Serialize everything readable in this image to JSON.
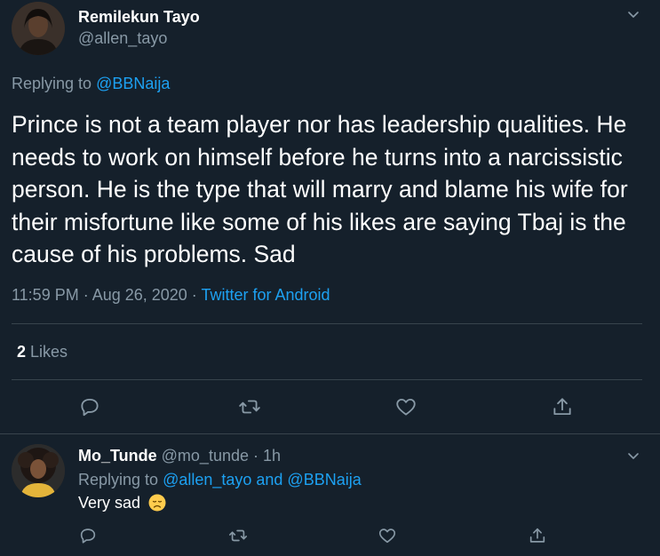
{
  "main_tweet": {
    "author_name": "Remilekun Tayo",
    "author_handle": "@allen_tayo",
    "replying_prefix": "Replying to",
    "replying_to": "@BBNaija",
    "text": "Prince is not a team player nor has leadership qualities. He needs to work on himself before he turns into a narcissistic person. He is the type that will marry and blame his wife for their misfortune like some of his likes are saying Tbaj is the cause of his problems. Sad",
    "timestamp": "11:59 PM · Aug 26, 2020 · ",
    "source": "Twitter for Android",
    "likes_count": "2",
    "likes_label": " Likes",
    "icons": {
      "reply": "reply-icon",
      "retweet": "retweet-icon",
      "like": "heart-icon",
      "share": "share-icon",
      "more": "chevron-down-icon"
    }
  },
  "reply_tweet": {
    "author_name": "Mo_Tunde",
    "author_handle": " @mo_tunde · 1h",
    "replying_prefix": "Replying to ",
    "replying_to": "@allen_tayo and @BBNaija",
    "text": "Very sad",
    "emoji": "disappointed-face-emoji"
  },
  "colors": {
    "background": "#15202b",
    "text_primary": "#ffffff",
    "text_secondary": "#8899a6",
    "link": "#1da1f2",
    "divider": "#38444d"
  }
}
